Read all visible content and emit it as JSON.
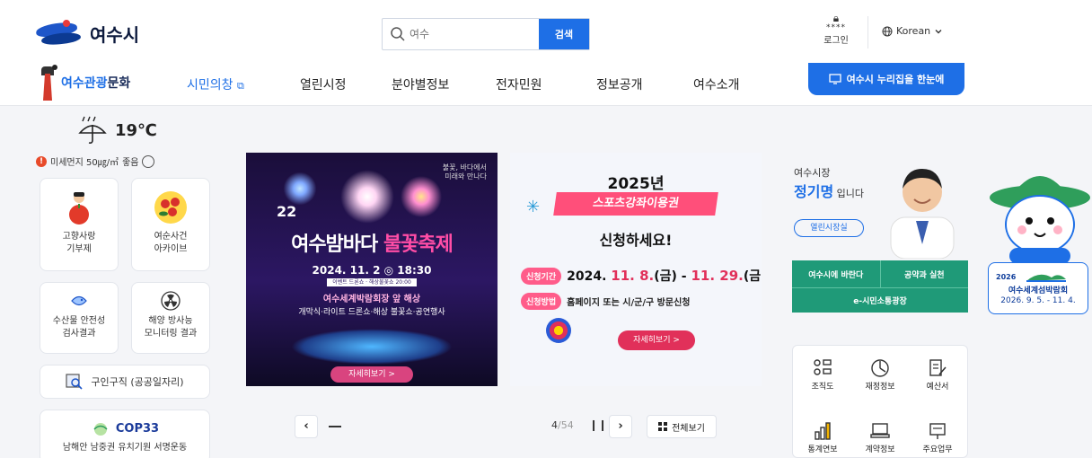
{
  "header": {
    "logo_text": "여수시",
    "search": {
      "placeholder": "여수",
      "button_label": "검색"
    },
    "login": {
      "stars": "****",
      "label": "로그인"
    },
    "language": "Korean"
  },
  "nav": {
    "brand_highlight": "여수관광",
    "brand_rest": "문화",
    "items": [
      {
        "label": "시민의창"
      },
      {
        "label": "열린시정"
      },
      {
        "label": "분야별정보"
      },
      {
        "label": "전자민원"
      },
      {
        "label": "정보공개"
      },
      {
        "label": "여수소개"
      }
    ],
    "cta": "여수시 누리집을 한눈에"
  },
  "weather": {
    "temp": "19℃",
    "dust_text": "미세먼지 50㎍/㎥",
    "dust_grade": "좋음"
  },
  "tiles": [
    {
      "line1": "고향사랑",
      "line2": "기부제"
    },
    {
      "line1": "여순사건",
      "line2": "아카이브"
    },
    {
      "line1": "수산물 안전성",
      "line2": "검사결과"
    },
    {
      "line1": "해양 방사능",
      "line2": "모니터링 결과"
    }
  ],
  "job_tile": "구인구직 (공공일자리)",
  "cop_tile": {
    "title": "COP33",
    "subtitle": "남해안 남중권 유치기원 서명운동"
  },
  "banner1": {
    "top_small_1": "불꽃, 바다에서",
    "top_small_2": "미래와 만나다",
    "edition": "22",
    "title_a": "여수밤바다 ",
    "title_b": "불꽃축제",
    "date": "2024. 11. 2 ◎ 18:30",
    "strip": "이벤트 드론쇼 · 해상불꽃쇼 20:00",
    "location": "여수세계박람회장 앞 해상",
    "program": "개막식·라이트 드론쇼·해상 불꽃쇼·공연행사",
    "button": "자세히보기 >"
  },
  "banner2": {
    "year": "2025년",
    "pill": "스포츠강좌이용권",
    "cta": "신청하세요!",
    "period_tag": "신청기간",
    "period_start": "2024. ",
    "period_start_red": "11. 8.",
    "period_start_day": "(금)",
    "period_sep": " - ",
    "period_end_red": "11. 29.",
    "period_end_day": "(금)",
    "method_tag": "신청방법",
    "method": "홈페이지 또는 시/군/구 방문신청",
    "button": "자세히보기 >"
  },
  "mayor": {
    "label": "여수시장",
    "name": "정기명",
    "name_tail": " 입니다",
    "pill": "열린시장실",
    "btn1": "여수시에 바란다",
    "btn2": "공약과 실천",
    "btn3": "e-시민소통광장"
  },
  "quick": [
    {
      "label": "조직도"
    },
    {
      "label": "재정정보"
    },
    {
      "label": "예산서"
    },
    {
      "label": "통계연보"
    },
    {
      "label": "계약정보"
    },
    {
      "label": "주요업무"
    }
  ],
  "expo": {
    "year": "2026",
    "title": "여수세계섬박람회",
    "dates": "2026. 9. 5. - 11. 4."
  },
  "pager": {
    "current": "4",
    "total": "/54",
    "view_all": "전체보기"
  },
  "colors": {
    "accent": "#1e6fe6",
    "green": "#1f9a78",
    "pink": "#ff4f7a",
    "navy": "#0d1a3d"
  }
}
